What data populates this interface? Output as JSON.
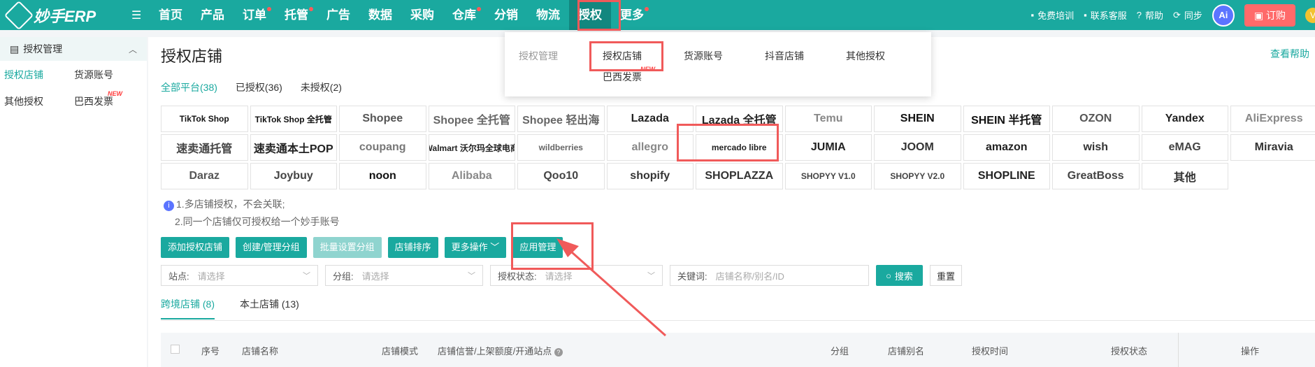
{
  "app": {
    "name": "妙手ERP"
  },
  "nav": {
    "items": [
      {
        "label": "首页",
        "dot": false,
        "active": false
      },
      {
        "label": "产品",
        "dot": false,
        "active": false
      },
      {
        "label": "订单",
        "dot": true,
        "active": false
      },
      {
        "label": "托管",
        "dot": true,
        "active": false
      },
      {
        "label": "广告",
        "dot": false,
        "active": false
      },
      {
        "label": "数据",
        "dot": false,
        "active": false
      },
      {
        "label": "采购",
        "dot": false,
        "active": false
      },
      {
        "label": "仓库",
        "dot": true,
        "active": false
      },
      {
        "label": "分销",
        "dot": false,
        "active": false
      },
      {
        "label": "物流",
        "dot": false,
        "active": false
      },
      {
        "label": "授权",
        "dot": false,
        "active": true
      },
      {
        "label": "更多",
        "dot": true,
        "active": false
      }
    ]
  },
  "topright": {
    "training": "免费培训",
    "service": "联系客服",
    "help": "帮助",
    "sync": "同步",
    "ai": "Ai",
    "order": "订购",
    "vip": "V"
  },
  "dropdown": {
    "header": "授权管理",
    "items": [
      "授权店铺",
      "货源账号",
      "抖音店铺",
      "其他授权"
    ],
    "extra": "巴西发票",
    "extra_tag": "NEW"
  },
  "sidebar": {
    "title": "授权管理",
    "items": [
      {
        "label": "授权店铺",
        "active": true,
        "tag": ""
      },
      {
        "label": "货源账号",
        "active": false,
        "tag": ""
      },
      {
        "label": "其他授权",
        "active": false,
        "tag": ""
      },
      {
        "label": "巴西发票",
        "active": false,
        "tag": "NEW"
      }
    ]
  },
  "page": {
    "title": "授权店铺",
    "help": "查看帮助"
  },
  "filter_tabs": [
    {
      "label": "全部平台(38)",
      "active": true
    },
    {
      "label": "已授权(36)",
      "active": false
    },
    {
      "label": "未授权(2)",
      "active": false
    }
  ],
  "platforms": [
    {
      "label": "TikTok Shop",
      "color": "#111111"
    },
    {
      "label": "TikTok Shop 全托管",
      "color": "#111111"
    },
    {
      "label": "Shopee",
      "color": "#555555"
    },
    {
      "label": "Shopee 全托管",
      "color": "#666666"
    },
    {
      "label": "Shopee 轻出海",
      "color": "#666666"
    },
    {
      "label": "Lazada",
      "color": "#222222"
    },
    {
      "label": "Lazada 全托管",
      "color": "#222222"
    },
    {
      "label": "Temu",
      "color": "#888888"
    },
    {
      "label": "SHEIN",
      "color": "#111111"
    },
    {
      "label": "SHEIN 半托管",
      "color": "#111111"
    },
    {
      "label": "OZON",
      "color": "#555555"
    },
    {
      "label": "Yandex",
      "color": "#222222"
    },
    {
      "label": "AliExpress",
      "color": "#888888"
    },
    {
      "label": "速卖通托管",
      "color": "#444444"
    },
    {
      "label": "速卖通本土POP",
      "color": "#222222"
    },
    {
      "label": "coupang",
      "color": "#777777"
    },
    {
      "label": "Walmart 沃尔玛全球电商",
      "color": "#222222"
    },
    {
      "label": "wildberries",
      "color": "#666666"
    },
    {
      "label": "allegro",
      "color": "#888888"
    },
    {
      "label": "mercado libre",
      "color": "#222222"
    },
    {
      "label": "JUMIA",
      "color": "#222222"
    },
    {
      "label": "JOOM",
      "color": "#333333"
    },
    {
      "label": "amazon",
      "color": "#222222"
    },
    {
      "label": "wish",
      "color": "#333333"
    },
    {
      "label": "eMAG",
      "color": "#444444"
    },
    {
      "label": "Miravia",
      "color": "#333333"
    },
    {
      "label": "Daraz",
      "color": "#555555"
    },
    {
      "label": "Joybuy",
      "color": "#444444"
    },
    {
      "label": "noon",
      "color": "#111111"
    },
    {
      "label": "Alibaba",
      "color": "#888888"
    },
    {
      "label": "Qoo10",
      "color": "#444444"
    },
    {
      "label": "shopify",
      "color": "#333333"
    },
    {
      "label": "SHOPLAZZA",
      "color": "#333333"
    },
    {
      "label": "SHOPYY V1.0",
      "color": "#444444"
    },
    {
      "label": "SHOPYY V2.0",
      "color": "#444444"
    },
    {
      "label": "SHOPLINE",
      "color": "#222222"
    },
    {
      "label": "GreatBoss",
      "color": "#444444"
    },
    {
      "label": "其他",
      "color": "#333333"
    }
  ],
  "tips": {
    "line1": "1.多店铺授权，不会关联;",
    "line2": "2.同一个店铺仅可授权给一个妙手账号"
  },
  "actions": [
    {
      "label": "添加授权店铺",
      "disabled": false
    },
    {
      "label": "创建/管理分组",
      "disabled": false
    },
    {
      "label": "批量设置分组",
      "disabled": true
    },
    {
      "label": "店铺排序",
      "disabled": false
    },
    {
      "label": "更多操作",
      "disabled": false,
      "caret": true
    },
    {
      "label": "应用管理",
      "disabled": false
    }
  ],
  "search": {
    "site_label": "站点:",
    "site_placeholder": "请选择",
    "group_label": "分组:",
    "group_placeholder": "请选择",
    "status_label": "授权状态:",
    "status_placeholder": "请选择",
    "keyword_label": "关键词:",
    "keyword_placeholder": "店铺名称/别名/ID",
    "search_btn": "搜索",
    "reset_btn": "重置"
  },
  "store_tabs": [
    {
      "label": "跨境店铺 (8)",
      "active": true
    },
    {
      "label": "本土店铺 (13)",
      "active": false
    }
  ],
  "table": {
    "headers": [
      "序号",
      "店铺名称",
      "店铺模式",
      "店铺信誉/上架额度/开通站点",
      "分组",
      "店铺别名",
      "授权时间",
      "授权状态",
      "操作"
    ]
  },
  "colors": {
    "brand": "#1aa99f",
    "highlight": "#f05a5a"
  }
}
